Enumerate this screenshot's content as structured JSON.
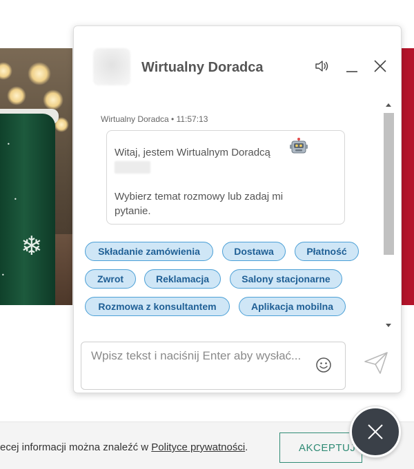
{
  "chat": {
    "title": "Wirtualny Doradca",
    "message": {
      "author": "Wirtualny Doradca",
      "time": "11:57:13",
      "meta": "Wirtualny Doradca • 11:57:13",
      "greeting": "Witaj, jestem Wirtualnym Doradcą",
      "prompt": "Wybierz temat rozmowy lub zadaj mi pytanie."
    },
    "quick_replies": [
      "Składanie zamówienia",
      "Dostawa",
      "Płatność",
      "Zwrot",
      "Reklamacja",
      "Salony stacjonarne",
      "Rozmowa z konsultantem",
      "Aplikacja mobilna"
    ],
    "input_placeholder": "Wpisz tekst i naciśnij Enter aby wysłać...",
    "colors": {
      "chip_bg": "#cfe6f6",
      "chip_border": "#4a9fd6",
      "chip_text": "#1f5f95"
    }
  },
  "cookie": {
    "text_before": "ecej informacji można znaleźć w ",
    "link": "Polityce prywatności",
    "text_after": ".",
    "accept_label": "AKCEPTUJ"
  },
  "icons": [
    "sound-icon",
    "minimize-icon",
    "close-icon",
    "robot-icon",
    "emoji-icon",
    "send-icon",
    "close-chat-icon"
  ],
  "colors": {
    "accent_red": "#b3142a",
    "accept_green": "#2e8a74",
    "fab_bg": "#3a4048"
  }
}
